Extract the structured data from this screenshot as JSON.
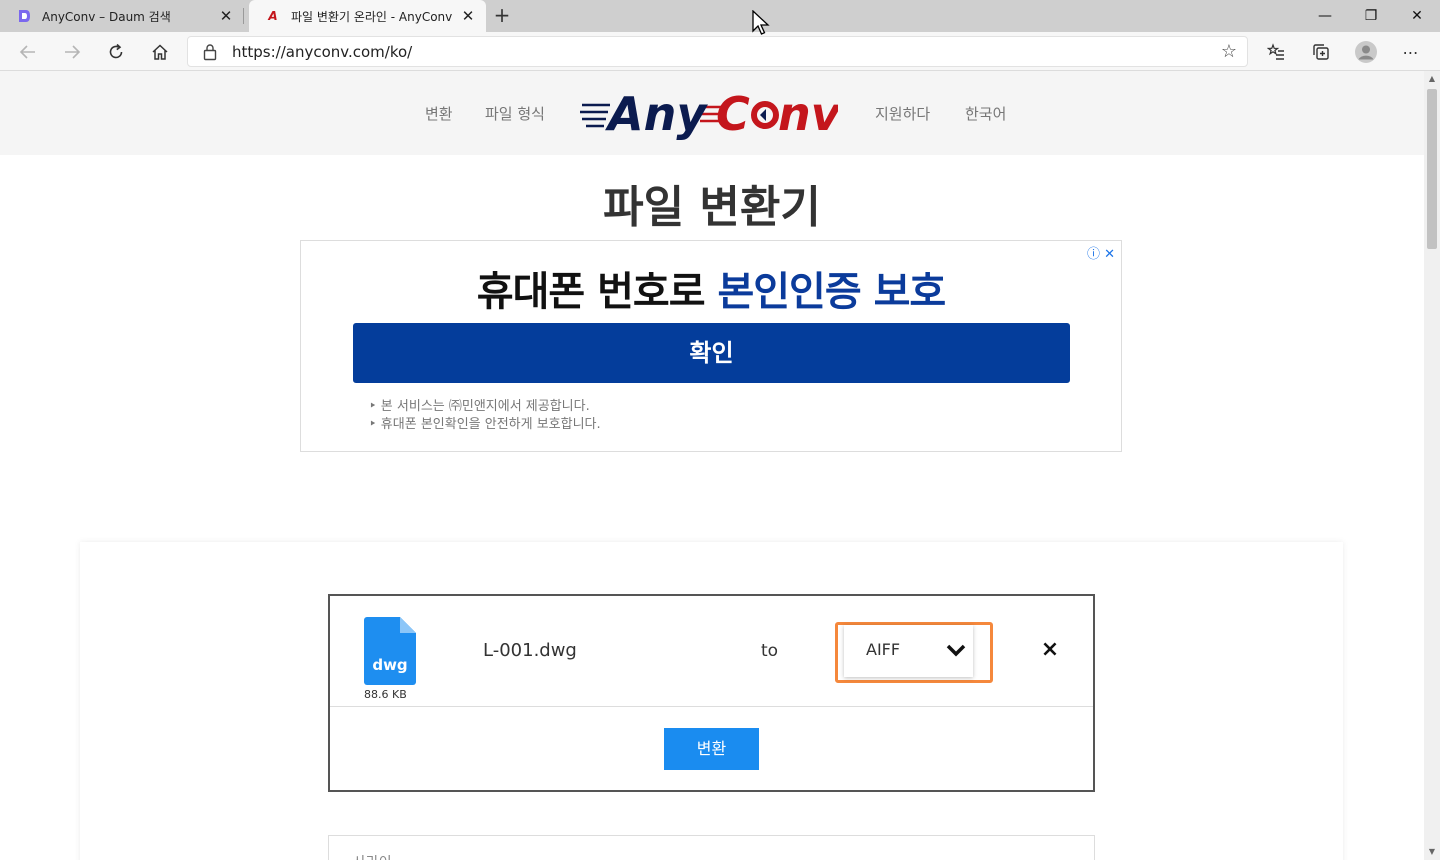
{
  "browser": {
    "tabs": [
      {
        "title": "AnyConv – Daum 검색",
        "active": false,
        "favicon": "daum-icon"
      },
      {
        "title": "파일 변환기 온라인 - AnyConv",
        "active": true,
        "favicon": "anyconv-icon"
      }
    ],
    "close_glyph": "✕",
    "new_tab_glyph": "+",
    "window_controls": {
      "minimize": "—",
      "restore": "❐",
      "close": "✕"
    },
    "address": {
      "url": "https://anyconv.com/ko/"
    }
  },
  "site": {
    "nav": {
      "left": [
        "변환",
        "파일 형식"
      ],
      "right": [
        "지원하다",
        "한국어"
      ]
    },
    "logo_text": "AnyConv",
    "page_title": "파일 변환기"
  },
  "ad": {
    "headline_plain": "휴대폰 번호로 ",
    "headline_highlight": "본인인증 보호",
    "cta_label": "확인",
    "notes": [
      "‣ 본 서비스는 ㈜민앤지에서 제공합니다.",
      "‣ 휴대폰 본인확인을 안전하게 보호합니다."
    ],
    "icons": "ⓘ ✕"
  },
  "converter": {
    "file": {
      "name": "L-001.dwg",
      "ext": "dwg",
      "size": "88.6 KB"
    },
    "to_label": "to",
    "selected_format": "AIFF",
    "remove_glyph": "×",
    "convert_label": "변환"
  },
  "below": {
    "partial_text": "사라이"
  },
  "colors": {
    "accent_blue": "#1a8cf0",
    "ad_blue": "#043d9b",
    "highlight_orange": "#f5883c",
    "logo_navy": "#0b1b4f",
    "logo_red": "#c4161c"
  }
}
